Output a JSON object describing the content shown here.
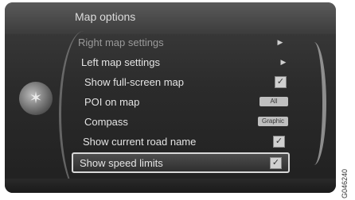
{
  "title": "Map options",
  "menu": {
    "items": [
      {
        "label": "Right map settings",
        "control": "arrow"
      },
      {
        "label": "Left map settings",
        "control": "arrow"
      },
      {
        "label": "Show full-screen map",
        "control": "checkbox",
        "checked": true
      },
      {
        "label": "POI on map",
        "control": "value",
        "value": "All"
      },
      {
        "label": "Compass",
        "control": "value",
        "value": "Graphic"
      },
      {
        "label": "Show current road name",
        "control": "checkbox",
        "checked": true
      },
      {
        "label": "Show speed limits",
        "control": "checkbox",
        "checked": true,
        "selected": true
      }
    ]
  },
  "icons": {
    "arrow": "right-arrow-icon",
    "checkbox": "check-icon",
    "knob": "compass-knob-icon"
  },
  "figure_code": "G046240"
}
